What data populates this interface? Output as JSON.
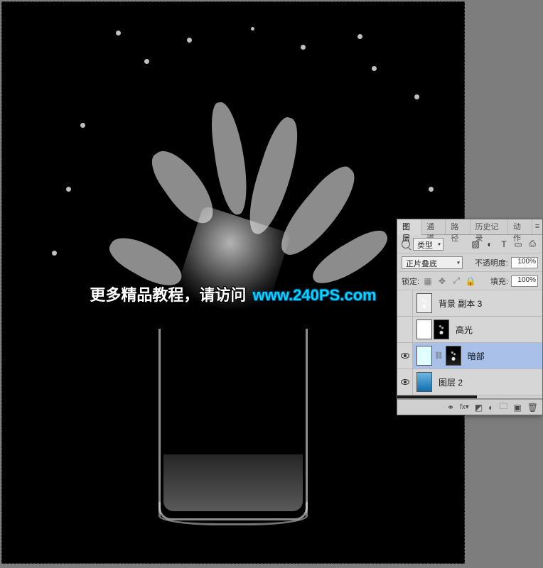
{
  "canvas": {
    "watermark_text": "更多精品教程，请访问",
    "watermark_url": "www.240PS.com"
  },
  "panel": {
    "tabs": [
      "图层",
      "通道",
      "路径",
      "历史记录",
      "动作"
    ],
    "activeTab": 0,
    "filter_type": "类型",
    "blend_mode": "正片叠底",
    "opacity_label": "不透明度:",
    "opacity_value": "100%",
    "lock_label": "锁定:",
    "fill_label": "填充:",
    "fill_value": "100%",
    "layers": [
      {
        "name": "背景 副本 3",
        "visible": false,
        "selected": false,
        "thumbs": [
          "splash"
        ]
      },
      {
        "name": "高光",
        "visible": false,
        "selected": false,
        "thumbs": [
          "mask",
          "splashdark"
        ]
      },
      {
        "name": "暗部",
        "visible": true,
        "selected": true,
        "thumbs": [
          "splash",
          "link",
          "splashdark"
        ]
      },
      {
        "name": "图层 2",
        "visible": true,
        "selected": false,
        "thumbs": [
          "sky"
        ]
      }
    ],
    "footer_icons": [
      "link",
      "fx",
      "mask",
      "adjust",
      "group",
      "new",
      "trash"
    ]
  }
}
